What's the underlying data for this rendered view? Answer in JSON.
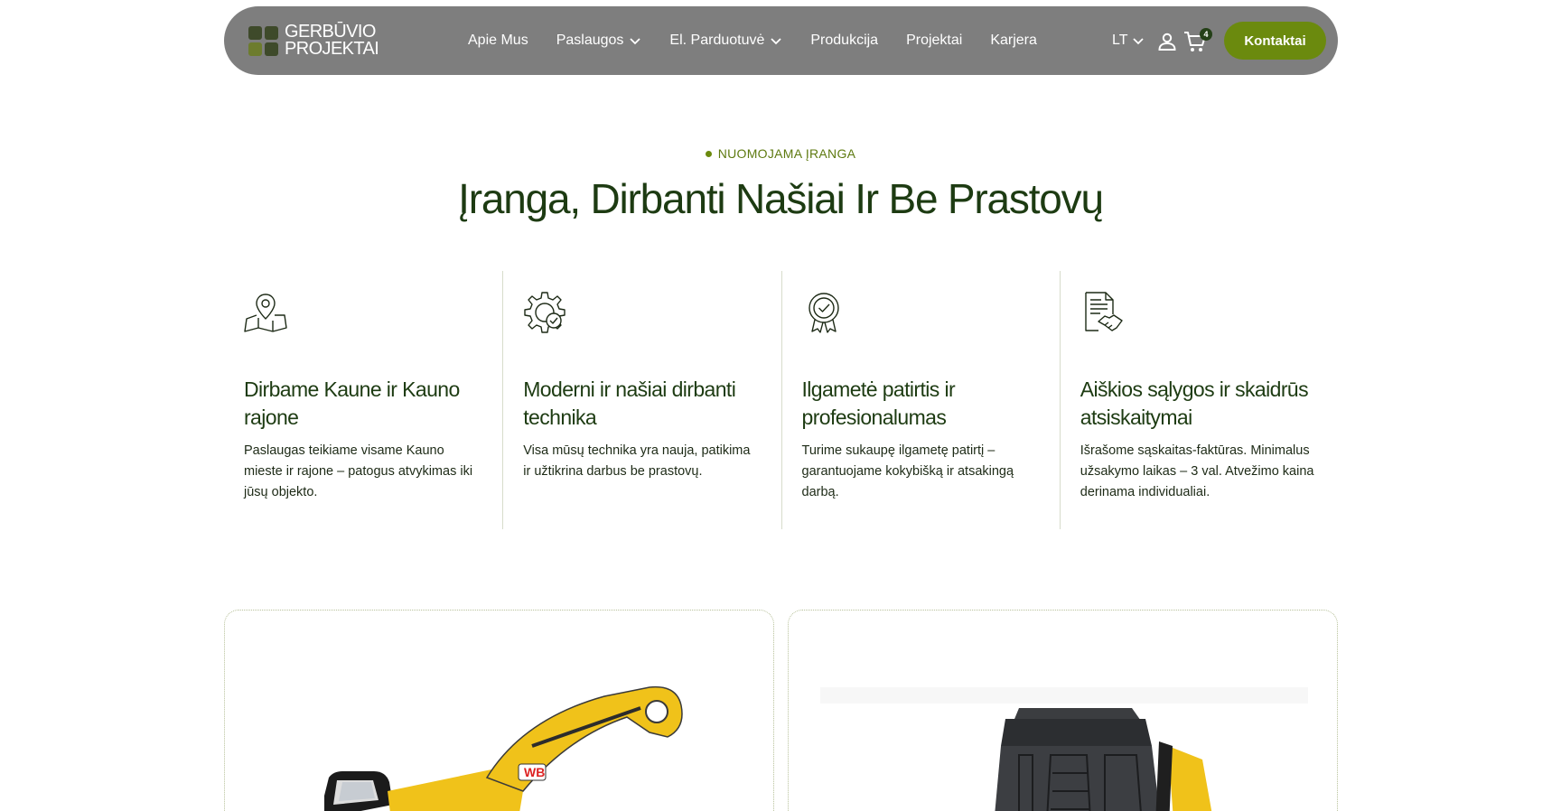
{
  "header": {
    "logo_line1": "GERBŪVIO",
    "logo_line2": "PROJEKTAI",
    "nav": [
      {
        "label": "Apie Mus",
        "dropdown": false
      },
      {
        "label": "Paslaugos",
        "dropdown": true
      },
      {
        "label": "El. Parduotuvė",
        "dropdown": true
      },
      {
        "label": "Produkcija",
        "dropdown": false
      },
      {
        "label": "Projektai",
        "dropdown": false
      },
      {
        "label": "Karjera",
        "dropdown": false
      }
    ],
    "language": "LT",
    "cart_count": "4",
    "contact_label": "Kontaktai"
  },
  "section": {
    "eyebrow": "NUOMOJAMA ĮRANGA",
    "title": "Įranga, Dirbanti Našiai Ir Be Prastovų"
  },
  "features": [
    {
      "icon": "map-pin-icon",
      "title": "Dirbame Kaune ir Kauno rajone",
      "desc": "Paslaugas teikiame visame Kauno mieste ir rajone – patogus atvykimas iki jūsų objekto."
    },
    {
      "icon": "gear-check-icon",
      "title": "Moderni ir našiai dirbanti technika",
      "desc": "Visa mūsų technika yra nauja, patikima ir užtikrina darbus be prastovų."
    },
    {
      "icon": "award-badge-icon",
      "title": "Ilgametė patirtis ir profesionalumas",
      "desc": "Turime sukaupę ilgametę patirtį – garantuojame kokybišką ir atsakingą darbą."
    },
    {
      "icon": "contract-handshake-icon",
      "title": "Aiškios sąlygos ir skaidrūs atsiskaitymai",
      "desc": "Išrašome sąskaitas-faktūras. Minimalus užsakymo laikas – 3 val. Atvežimo kaina derinama individualiai."
    }
  ],
  "colors": {
    "header_bg": "#7e7e7e",
    "accent": "#6b8a0e",
    "heading": "#1d3b12"
  },
  "cards": [
    {
      "image": "excavator-image"
    },
    {
      "image": "skid-steer-loader-image"
    }
  ]
}
